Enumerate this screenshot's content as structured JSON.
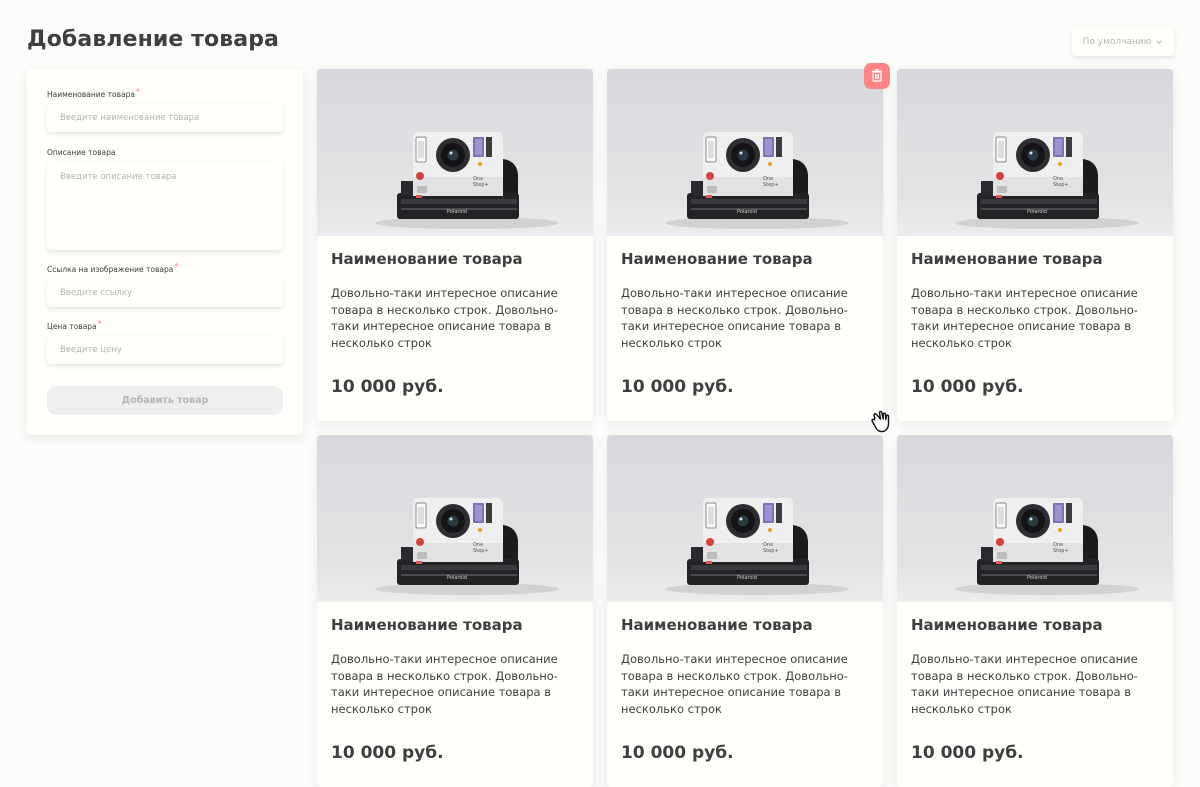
{
  "header": {
    "title": "Добавление товара"
  },
  "sort": {
    "selected": "По умолчанию",
    "icon": "chevron-down-icon"
  },
  "form": {
    "name": {
      "label": "Наименование товара",
      "required": "*",
      "placeholder": "Введите наименование товара"
    },
    "description": {
      "label": "Описание товара",
      "placeholder": "Введите описание товара"
    },
    "image_link": {
      "label": "Ссылка на изображение товара",
      "required": "*",
      "placeholder": "Введите ссылку"
    },
    "price": {
      "label": "Цена товара",
      "required": "*",
      "placeholder": "Введите цену"
    },
    "submit_label": "Добавить товар"
  },
  "products": [
    {
      "title": "Наименование товара",
      "description": "Довольно-таки интересное описание товара в несколько строк. Довольно-таки интересное описание товара в несколько строк",
      "price": "10 000 руб.",
      "image": "polaroid-camera-photo"
    },
    {
      "title": "Наименование товара",
      "description": "Довольно-таки интересное описание товара в несколько строк. Довольно-таки интересное описание товара в несколько строк",
      "price": "10 000 руб.",
      "image": "polaroid-camera-photo"
    },
    {
      "title": "Наименование товара",
      "description": "Довольно-таки интересное описание товара в несколько строк. Довольно-таки интересное описание товара в несколько строк",
      "price": "10 000 руб.",
      "image": "polaroid-camera-photo"
    },
    {
      "title": "Наименование товара",
      "description": "Довольно-таки интересное описание товара в несколько строк. Довольно-таки интересное описание товара в несколько строк",
      "price": "10 000 руб.",
      "image": "polaroid-camera-photo"
    },
    {
      "title": "Наименование товара",
      "description": "Довольно-таки интересное описание товара в несколько строк. Довольно-таки интересное описание товара в несколько строк",
      "price": "10 000 руб.",
      "image": "polaroid-camera-photo"
    },
    {
      "title": "Наименование товара",
      "description": "Довольно-таки интересное описание товара в несколько строк. Довольно-таки интересное описание товара в несколько строк",
      "price": "10 000 руб.",
      "image": "polaroid-camera-photo"
    }
  ],
  "delete_action": {
    "icon": "trash-icon"
  },
  "colors": {
    "background": "#fcfcfa",
    "card": "#fffefb",
    "text": "#3f3f3f",
    "placeholder": "#b4b4b4",
    "required": "#ff8585",
    "delete": "#ff8585",
    "button_disabled": "#eeeeee"
  }
}
